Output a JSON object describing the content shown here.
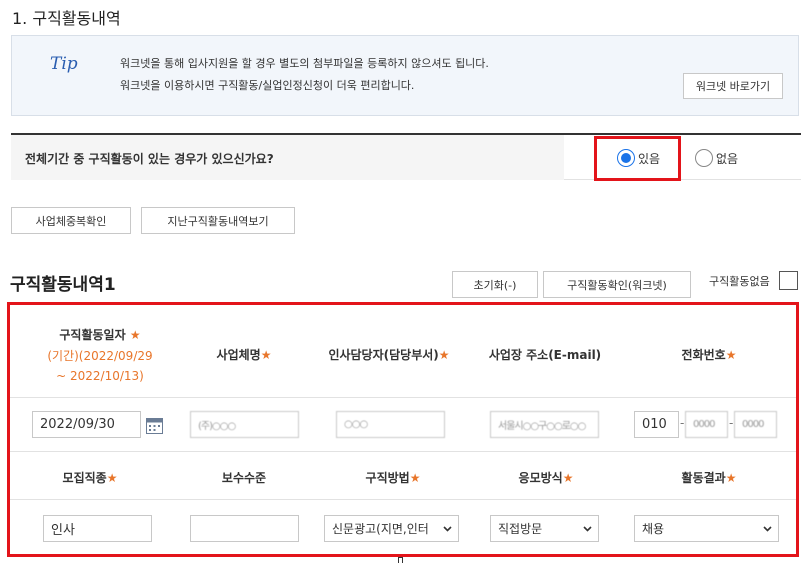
{
  "section": {
    "title": "1. 구직활동내역"
  },
  "tip": {
    "label": "Tip",
    "line1": "워크넷을 통해 입사지원을 할 경우 별도의 첨부파일을 등록하지 않으셔도 됩니다.",
    "line2": "워크넷을 이용하시면 구직활동/실업인정신청이 더욱 편리합니다.",
    "button": "워크넷 바로가기"
  },
  "question": {
    "text": "전체기간 중 구직활동이 있는 경우가 있으신가요?",
    "options": [
      "있음",
      "없음"
    ],
    "selected": "있음"
  },
  "buttons": {
    "business_dup": "사업체중복확인",
    "past_activity": "지난구직활동내역보기"
  },
  "list": {
    "title": "구직활동내역1",
    "reset": "초기화(-)",
    "check": "구직활동확인(워크넷)",
    "no_activity": "구직활동없음",
    "no_activity_checked": false
  },
  "row1_headers": {
    "date": "구직활동일자",
    "period_line1": "(기간)(2022/09/29",
    "period_line2": "~ 2022/10/13)",
    "company": "사업체명",
    "hr_manager": "인사담당자(담당부서)",
    "address": "사업장 주소(E-mail)",
    "phone": "전화번호"
  },
  "row1_values": {
    "date": "2022/09/30",
    "company": "(주)○○○",
    "hr_manager": "○○○",
    "address": "서울시○○구○○로○○",
    "phone1": "010",
    "phone2": "0000",
    "phone3": "0000"
  },
  "row2_headers": {
    "job_type": "모집직종",
    "pay": "보수수준",
    "method": "구직방법",
    "apply_type": "응모방식",
    "result": "활동결과"
  },
  "row2_values": {
    "job_type": "인사",
    "pay": "",
    "method": "신문광고(지면,인터",
    "apply_type": "직접방문",
    "result": "채용"
  },
  "required_mark": "★",
  "colors": {
    "accent_red": "#e3141a",
    "required_orange": "#e8762b",
    "radio_blue": "#1a73e8"
  },
  "icons": {
    "calendar": "calendar-icon",
    "select_arrow": "chevron-down-icon"
  }
}
